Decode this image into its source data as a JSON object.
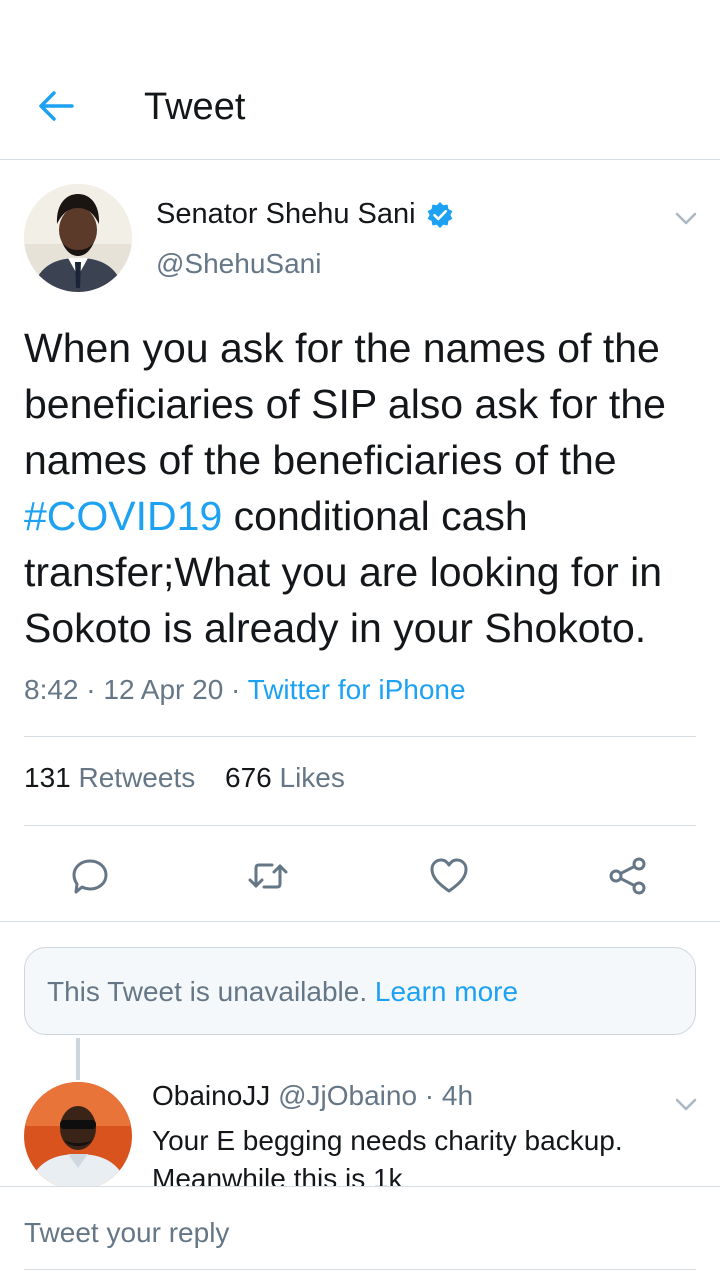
{
  "header": {
    "title": "Tweet"
  },
  "tweet": {
    "author_name": "Senator Shehu Sani",
    "author_handle": "@ShehuSani",
    "text_before": "When you ask for the names of the beneficiaries of SIP also ask for the names of the beneficiaries of the ",
    "hashtag": "#COVID19",
    "text_after": " conditional cash transfer;What you are looking for in Sokoto is already in your Shokoto.",
    "time": "8:42",
    "date": "12 Apr 20",
    "separator": "·",
    "source": "Twitter for iPhone",
    "retweets_count": "131",
    "retweets_label": "Retweets",
    "likes_count": "676",
    "likes_label": "Likes"
  },
  "unavailable": {
    "text": "This Tweet is unavailable.",
    "link": "Learn more"
  },
  "reply": {
    "name": "ObainoJJ",
    "handle": "@JjObaino",
    "age": "4h",
    "text": "Your E begging needs charity backup. Meanwhile this is 1k"
  },
  "compose": {
    "placeholder": "Tweet your reply"
  },
  "colors": {
    "accent": "#1da1f2",
    "text": "#14171a",
    "muted": "#657786",
    "divider": "#d6dde3"
  },
  "icons": [
    "back-arrow-icon",
    "verified-icon",
    "chevron-down-icon",
    "reply-icon",
    "retweet-icon",
    "like-icon",
    "share-icon"
  ]
}
